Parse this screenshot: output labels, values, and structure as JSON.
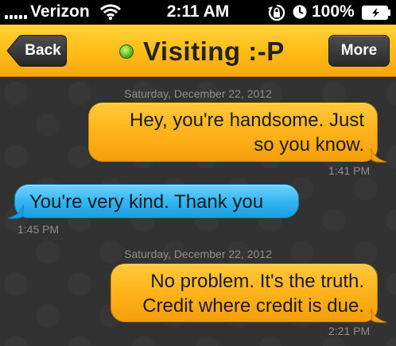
{
  "status_bar": {
    "carrier": "Verizon",
    "time": "2:11 AM",
    "battery_percent": "100%",
    "icons": [
      "signal-icon",
      "wifi-icon",
      "orientation-lock-icon",
      "alarm-icon",
      "battery-icon"
    ]
  },
  "nav": {
    "back_label": "Back",
    "title": "Visiting :-P",
    "more_label": "More",
    "status_color": "#5fbf1c",
    "accent_color": "#ffbf1a"
  },
  "messages": [
    {
      "date": "Saturday, December 22, 2012",
      "direction": "sent",
      "lines": [
        "Hey, you're handsome. Just",
        "so you know."
      ],
      "time": "1:41 PM"
    },
    {
      "direction": "received",
      "lines": [
        "You're very kind. Thank you"
      ],
      "time": "1:45 PM"
    },
    {
      "date": "Saturday, December 22, 2012",
      "direction": "sent",
      "lines": [
        "No problem. It's the truth.",
        "Credit where credit is due."
      ],
      "time": "2:21 PM"
    }
  ],
  "colors": {
    "sent_bubble": "#ffb31a",
    "received_bubble": "#35b6f2",
    "background": "#323232"
  }
}
